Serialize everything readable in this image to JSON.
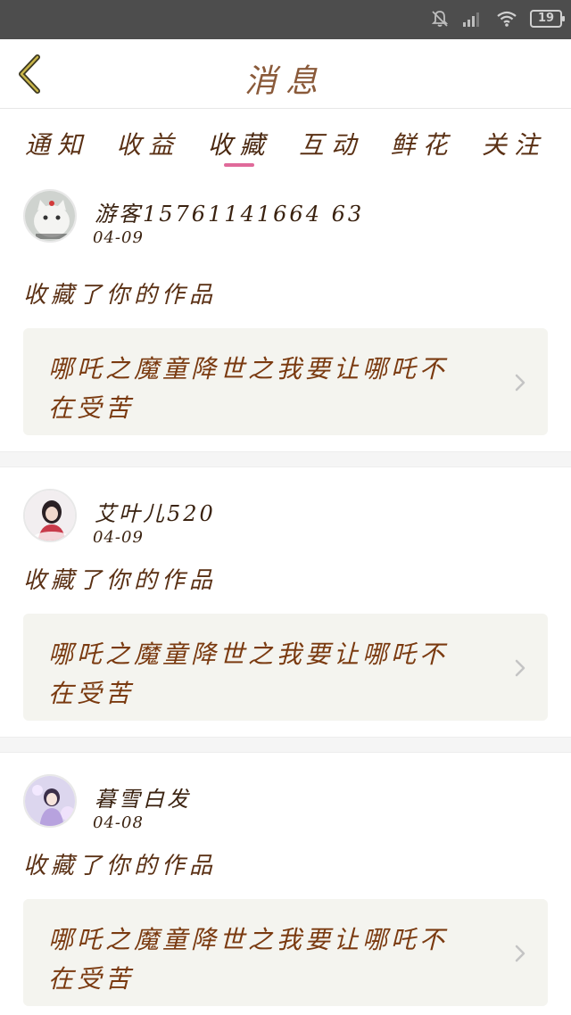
{
  "status_bar": {
    "carrier": "",
    "battery": "19"
  },
  "header": {
    "title": "消息",
    "back_icon": "chevron-left-icon"
  },
  "tabs": [
    {
      "label": "通知",
      "active": false
    },
    {
      "label": "收益",
      "active": false
    },
    {
      "label": "收藏",
      "active": true
    },
    {
      "label": "互动",
      "active": false
    },
    {
      "label": "鲜花",
      "active": false
    },
    {
      "label": "关注",
      "active": false
    }
  ],
  "accent_color": "#e06a9a",
  "feed": [
    {
      "username": "游客15761141664 63",
      "date": "04-09",
      "action": "收藏了你的作品",
      "work_title_line1": "哪吒之魔童降世之我要让哪吒不",
      "work_title_line2": "在受苦"
    },
    {
      "username": "艾叶儿520",
      "date": "04-09",
      "action": "收藏了你的作品",
      "work_title_line1": "哪吒之魔童降世之我要让哪吒不",
      "work_title_line2": "在受苦"
    },
    {
      "username": "暮雪白发",
      "date": "04-08",
      "action": "收藏了你的作品",
      "work_title_line1": "哪吒之魔童降世之我要让哪吒不",
      "work_title_line2": "在受苦"
    }
  ]
}
